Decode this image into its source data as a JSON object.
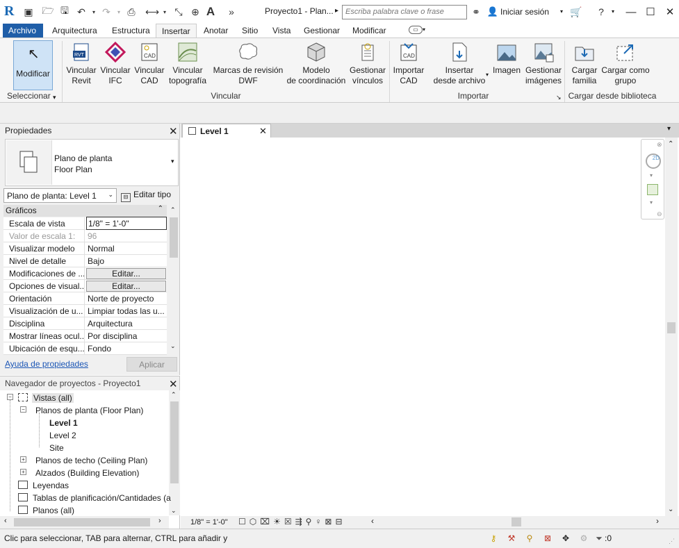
{
  "titlebar": {
    "app_logo": "R",
    "doc_title": "Proyecto1 - Plan...",
    "search_placeholder": "Escriba palabra clave o frase",
    "signin_label": "Iniciar sesión",
    "quick_access_icons": [
      "open-icon",
      "save-icon",
      "undo-icon",
      "redo-icon",
      "print-icon",
      "measure-icon",
      "dimension-icon",
      "tag-icon",
      "text-icon"
    ]
  },
  "tabs": [
    "Archivo",
    "Arquitectura",
    "Estructura",
    "Insertar",
    "Anotar",
    "Sitio",
    "Vista",
    "Gestionar",
    "Modificar"
  ],
  "ribbon": {
    "modify": {
      "label": "Modificar",
      "group": "Seleccionar"
    },
    "vincular_buttons": [
      {
        "line1": "Vincular",
        "line2": "Revit",
        "icon": "rvt-link-icon"
      },
      {
        "line1": "Vincular",
        "line2": "IFC",
        "icon": "ifc-link-icon"
      },
      {
        "line1": "Vincular",
        "line2": "CAD",
        "icon": "cad-link-icon"
      },
      {
        "line1": "Vincular",
        "line2": "topografía",
        "icon": "topography-link-icon"
      },
      {
        "line1": "Marcas de revisión",
        "line2": "DWF",
        "icon": "dwf-markup-icon"
      },
      {
        "line1": "Modelo",
        "line2": "de coordinación",
        "icon": "coordination-model-icon"
      },
      {
        "line1": "Gestionar",
        "line2": "vínculos",
        "icon": "manage-links-icon"
      }
    ],
    "importar_buttons": [
      {
        "line1": "Importar",
        "line2": "CAD",
        "icon": "import-cad-icon"
      },
      {
        "line1": "Insertar",
        "line2": "desde archivo",
        "icon": "insert-file-icon"
      },
      {
        "line1": "Imagen",
        "line2": "",
        "icon": "image-icon"
      },
      {
        "line1": "Gestionar",
        "line2": "imágenes",
        "icon": "manage-images-icon"
      }
    ],
    "biblioteca_buttons": [
      {
        "line1": "Cargar",
        "line2": "familia",
        "icon": "load-family-icon"
      },
      {
        "line1": "Cargar como",
        "line2": "grupo",
        "icon": "load-group-icon"
      }
    ],
    "groups": {
      "vincular": "Vincular",
      "importar": "Importar",
      "biblioteca": "Cargar desde biblioteca"
    }
  },
  "properties": {
    "title": "Propiedades",
    "type_line1": "Plano de planta",
    "type_line2": "Floor Plan",
    "instance_selector": "Plano de planta: Level 1",
    "edit_type": "Editar tipo",
    "section": "Gráficos",
    "rows": [
      {
        "k": "Escala de vista",
        "v": "1/8\" = 1'-0\""
      },
      {
        "k": "Valor de escala    1:",
        "v": "96"
      },
      {
        "k": "Visualizar modelo",
        "v": "Normal"
      },
      {
        "k": "Nivel de detalle",
        "v": "Bajo"
      },
      {
        "k": "Modificaciones de ...",
        "v": "Editar..."
      },
      {
        "k": "Opciones de visual...",
        "v": "Editar..."
      },
      {
        "k": "Orientación",
        "v": "Norte de proyecto"
      },
      {
        "k": "Visualización de u...",
        "v": "Limpiar todas las u..."
      },
      {
        "k": "Disciplina",
        "v": "Arquitectura"
      },
      {
        "k": "Mostrar líneas ocul...",
        "v": "Por disciplina"
      },
      {
        "k": "Ubicación de esqu...",
        "v": "Fondo"
      }
    ],
    "help_link": "Ayuda de propiedades",
    "apply": "Aplicar"
  },
  "browser": {
    "title": "Navegador de proyectos - Proyecto1",
    "nodes": [
      {
        "label": "Vistas (all)"
      },
      {
        "label": "Planos de planta (Floor Plan)"
      },
      {
        "label": "Level 1"
      },
      {
        "label": "Level 2"
      },
      {
        "label": "Site"
      },
      {
        "label": "Planos de techo (Ceiling Plan)"
      },
      {
        "label": "Alzados (Building Elevation)"
      },
      {
        "label": "Leyendas"
      },
      {
        "label": "Tablas de planificación/Cantidades (a"
      },
      {
        "label": "Planos (all)"
      }
    ]
  },
  "view": {
    "tab_label": "Level 1",
    "scale": "1/8\" = 1'-0\""
  },
  "status": {
    "message": "Clic para seleccionar, TAB para alternar, CTRL para añadir y",
    "filter_count": ":0"
  }
}
